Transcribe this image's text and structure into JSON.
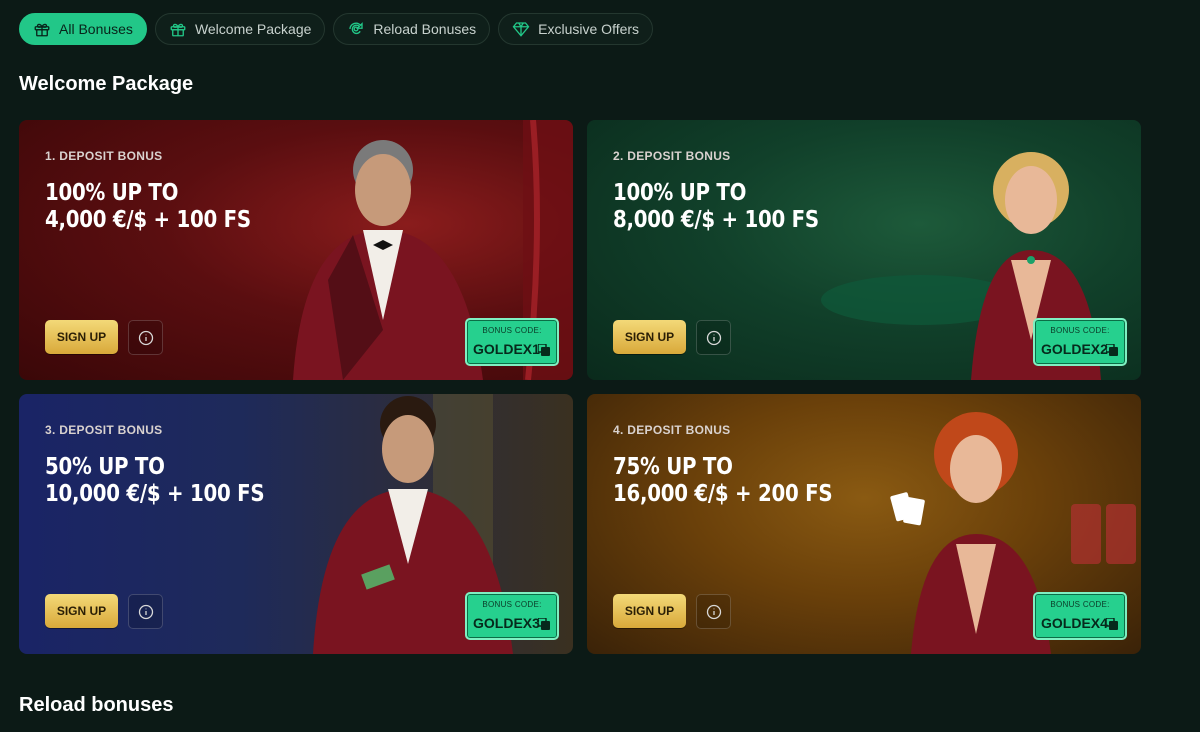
{
  "tabs": [
    {
      "label": "All Bonuses",
      "icon": "gift-icon",
      "active": true
    },
    {
      "label": "Welcome Package",
      "icon": "gift-icon",
      "active": false
    },
    {
      "label": "Reload Bonuses",
      "icon": "reload-icon",
      "active": false
    },
    {
      "label": "Exclusive Offers",
      "icon": "diamond-icon",
      "active": false
    }
  ],
  "sections": {
    "welcome_title": "Welcome Package",
    "reload_title": "Reload bonuses"
  },
  "cards": [
    {
      "kicker": "1. DEPOSIT BONUS",
      "line1": "100% UP TO",
      "line2": "4,000 €/$ + 100 FS",
      "signup": "SIGN UP",
      "code_label": "BONUS CODE:",
      "code": "GOLDEX1",
      "theme": "#7a1518"
    },
    {
      "kicker": "2. DEPOSIT BONUS",
      "line1": "100% UP TO",
      "line2": "8,000 €/$ + 100 FS",
      "signup": "SIGN UP",
      "code_label": "BONUS CODE:",
      "code": "GOLDEX2",
      "theme": "#0f4a30"
    },
    {
      "kicker": "3. DEPOSIT BONUS",
      "line1": "50% UP TO",
      "line2": "10,000 €/$ + 100 FS",
      "signup": "SIGN UP",
      "code_label": "BONUS CODE:",
      "code": "GOLDEX3",
      "theme": "#1d2a6a"
    },
    {
      "kicker": "4. DEPOSIT BONUS",
      "line1": "75% UP TO",
      "line2": "16,000 €/$ + 200 FS",
      "signup": "SIGN UP",
      "code_label": "BONUS CODE:",
      "code": "GOLDEX4",
      "theme": "#7a4a0a"
    }
  ],
  "colors": {
    "accent": "#22c788",
    "background": "#0c1a16",
    "button_gold": "#e8c45a"
  }
}
